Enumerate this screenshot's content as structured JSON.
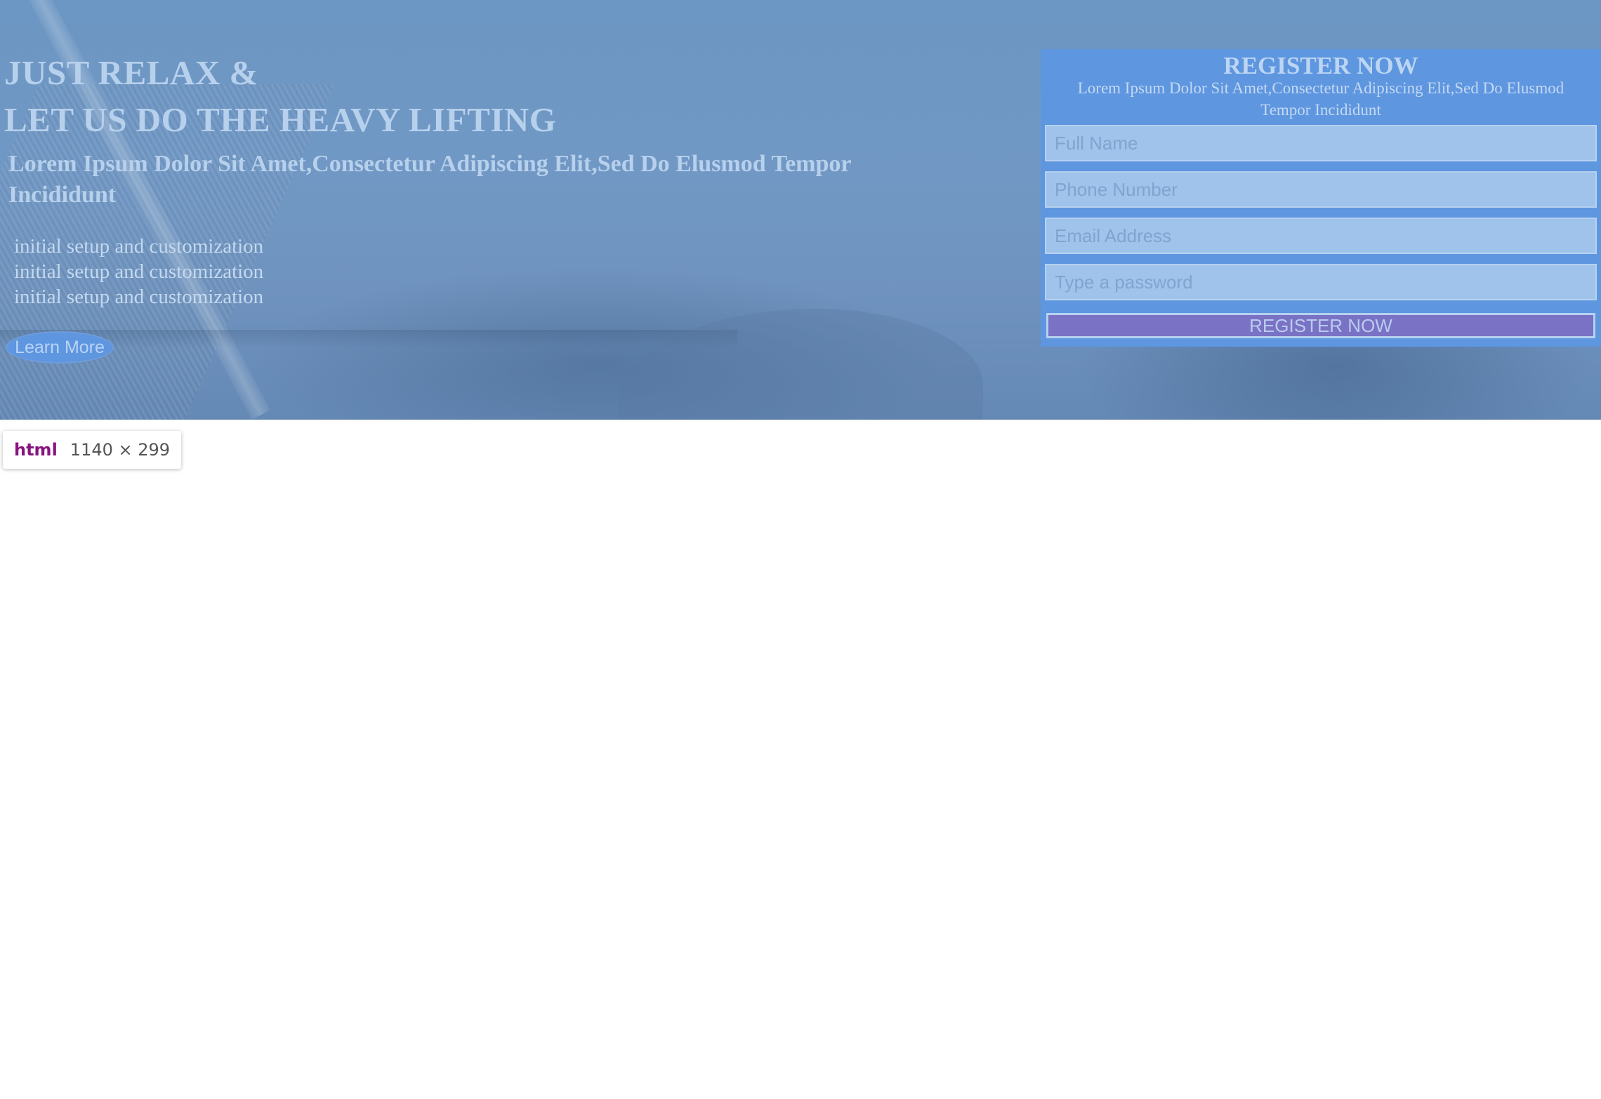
{
  "hero": {
    "headline_line1": "JUST RELAX &",
    "headline_line2": "LET US DO THE HEAVY LIFTING",
    "subheading": "Lorem Ipsum Dolor Sit Amet,Consectetur Adipiscing Elit,Sed Do Elusmod Tempor Incididunt",
    "features": [
      "initial setup and customization",
      "initial setup and customization",
      "initial setup and customization"
    ],
    "learn_more_label": "Learn More"
  },
  "register_form": {
    "title": "REGISTER NOW",
    "description": "Lorem Ipsum Dolor Sit Amet,Consectetur Adipiscing Elit,Sed Do Elusmod Tempor Incididunt",
    "full_name_placeholder": "Full Name",
    "phone_placeholder": "Phone Number",
    "email_placeholder": "Email Address",
    "password_placeholder": "Type a password",
    "submit_label": "REGISTER NOW"
  },
  "inspector_tooltip": {
    "tag": "html",
    "dimensions": "1140 × 299"
  },
  "colors": {
    "overlay": "#6c96c3",
    "form_background": "#5e96e0",
    "submit_button": "#7a72c4",
    "tooltip_tag": "#881280"
  }
}
